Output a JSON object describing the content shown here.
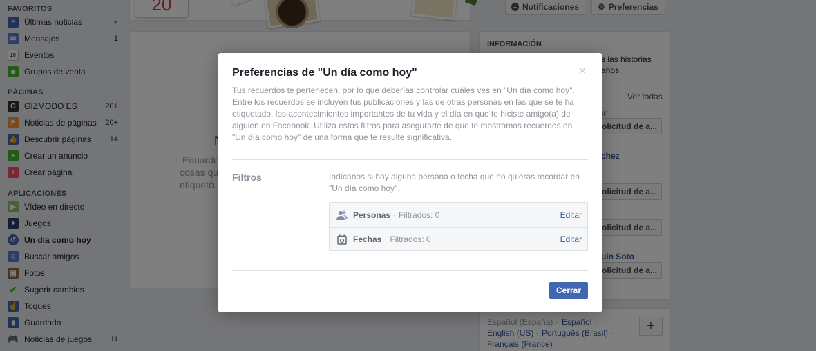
{
  "sidebar": {
    "favoritos_title": "FAVORITOS",
    "paginas_title": "PÁGINAS",
    "aplicaciones_title": "APLICACIONES",
    "favoritos": [
      {
        "label": "Últimas noticias",
        "count": "",
        "icon": "news-feed-icon"
      },
      {
        "label": "Mensajes",
        "count": "1",
        "icon": "messages-icon"
      },
      {
        "label": "Eventos",
        "count": "",
        "icon": "events-icon"
      },
      {
        "label": "Grupos de venta",
        "count": "",
        "icon": "sale-groups-icon"
      }
    ],
    "paginas": [
      {
        "label": "GIZMODO ES",
        "count": "20+",
        "icon": "gizmodo-icon"
      },
      {
        "label": "Noticias de páginas",
        "count": "20+",
        "icon": "pages-feed-icon"
      },
      {
        "label": "Descubrir páginas",
        "count": "14",
        "icon": "discover-pages-icon"
      },
      {
        "label": "Crear un anuncio",
        "count": "",
        "icon": "create-ad-icon"
      },
      {
        "label": "Crear página",
        "count": "",
        "icon": "create-page-icon"
      }
    ],
    "aplicaciones": [
      {
        "label": "Vídeo en directo",
        "count": "",
        "icon": "live-video-icon"
      },
      {
        "label": "Juegos",
        "count": "",
        "icon": "games-icon"
      },
      {
        "label": "Un día como hoy",
        "count": "",
        "icon": "on-this-day-icon"
      },
      {
        "label": "Buscar amigos",
        "count": "",
        "icon": "find-friends-icon"
      },
      {
        "label": "Fotos",
        "count": "",
        "icon": "photos-icon"
      },
      {
        "label": "Sugerir cambios",
        "count": "",
        "icon": "suggest-edits-icon"
      },
      {
        "label": "Toques",
        "count": "",
        "icon": "pokes-icon"
      },
      {
        "label": "Guardado",
        "count": "",
        "icon": "saved-icon"
      },
      {
        "label": "Noticias de juegos",
        "count": "11",
        "icon": "game-feed-icon"
      }
    ]
  },
  "header": {
    "calendar_day": "20",
    "notificaciones_label": "Notificaciones",
    "preferencias_label": "Preferencias"
  },
  "main": {
    "big_letter": "N",
    "line1": "Eduardo",
    "line2": "cosas qu",
    "line3": "etiquetó."
  },
  "right": {
    "info_title": "INFORMACIÓN",
    "info_line1": "s las historias",
    "info_line2": "años.",
    "ver_todas": "Ver todas",
    "name1": "ir",
    "name2": "chez",
    "name3": "uin Soto",
    "request_label": "olicitud de a..."
  },
  "languages": {
    "current": "Español (España)",
    "sep": " · ",
    "items": [
      "Español",
      "English (US)",
      "Português (Brasil)",
      "Français (France)"
    ]
  },
  "modal": {
    "title": "Preferencias de \"Un día como hoy\"",
    "close_glyph": "×",
    "description": "Tus recuerdos te pertenecen, por lo que deberías controlar cuáles ves en \"Un día como hoy\". Entre los recuerdos se incluyen tus publicaciones y las de otras personas en las que se te ha etiquetado, los acontecimientos importantes de tu vida y el día en que te hiciste amigo(a) de alguien en Facebook. Utiliza estos filtros para asegurarte de que te mostramos recuerdos en \"Un día como hoy\" de una forma que te resulte significativa.",
    "filters_label": "Filtros",
    "filters_description": "Indícanos si hay alguna persona o fecha que no quieras recordar en \"Un día como hoy\".",
    "filters": [
      {
        "name": "Personas",
        "sep": "·",
        "count_text": "Filtrados: 0",
        "edit": "Editar",
        "icon": "people-icon"
      },
      {
        "name": "Fechas",
        "sep": "·",
        "count_text": "Filtrados: 0",
        "edit": "Editar",
        "icon": "calendar-icon"
      }
    ],
    "close_button": "Cerrar"
  },
  "colors": {
    "accent": "#4267b2",
    "link": "#365899",
    "muted": "#90949c"
  }
}
